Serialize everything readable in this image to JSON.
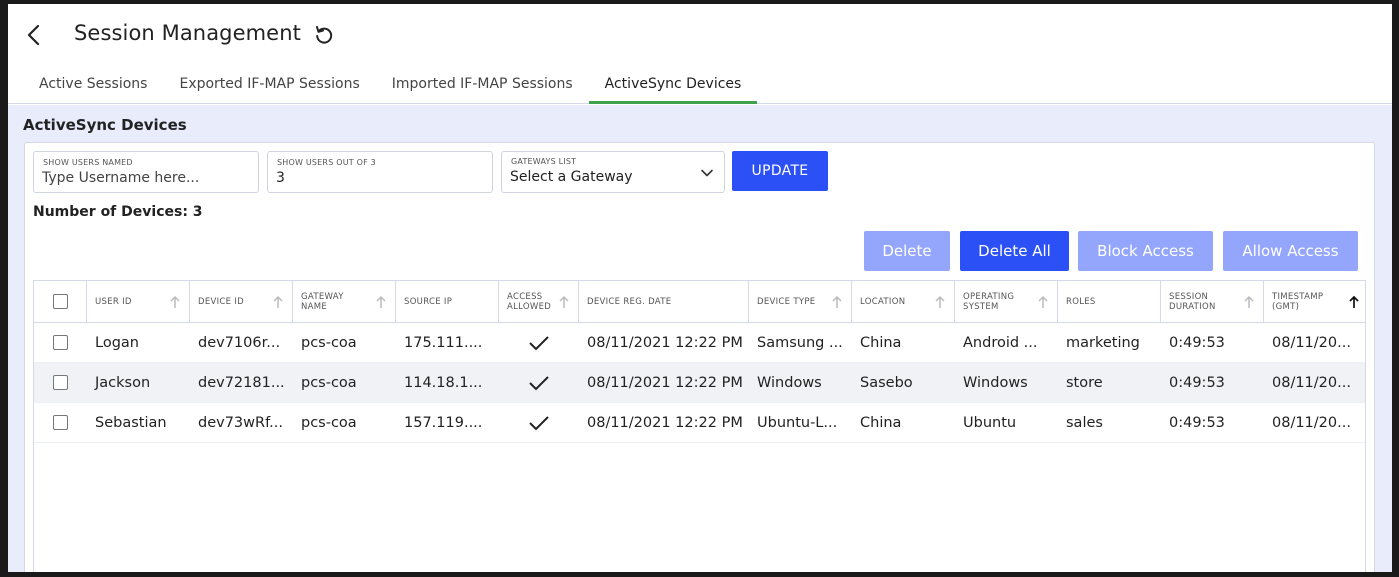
{
  "header": {
    "title": "Session Management",
    "back_icon": "chevron-left-icon",
    "refresh_icon": "refresh-icon"
  },
  "tabs": [
    {
      "label": "Active Sessions",
      "active": false
    },
    {
      "label": "Exported IF-MAP Sessions",
      "active": false
    },
    {
      "label": "Imported IF-MAP Sessions",
      "active": false
    },
    {
      "label": "ActiveSync Devices",
      "active": true
    }
  ],
  "colors": {
    "accent": "#2b50f5",
    "accent_disabled": "#94a6fb",
    "tab_underline": "#3fa34d",
    "content_bg": "#e8ecfb"
  },
  "section": {
    "title": "ActiveSync Devices"
  },
  "filters": {
    "username": {
      "label": "SHOW USERS NAMED",
      "placeholder": "Type Username here...",
      "value": ""
    },
    "limit": {
      "label": "SHOW USERS OUT OF 3",
      "value": "3"
    },
    "gateway": {
      "label": "GATEWAYS LIST",
      "value": "Select a Gateway"
    },
    "update_label": "UPDATE"
  },
  "count_text": "Number of Devices: 3",
  "actions": {
    "delete": "Delete",
    "delete_all": "Delete All",
    "block": "Block Access",
    "allow": "Allow Access"
  },
  "table": {
    "columns": [
      "USER ID",
      "DEVICE ID",
      "GATEWAY NAME",
      "SOURCE IP",
      "ACCESS ALLOWED",
      "DEVICE REG. DATE",
      "DEVICE TYPE",
      "LOCATION",
      "OPERATING SYSTEM",
      "ROLES",
      "SESSION DURATION",
      "TIMESTAMP (GMT)"
    ],
    "rows": [
      {
        "user": "Logan",
        "device": "dev7106r...",
        "gateway": "pcs-coa",
        "ip": "175.111....",
        "allowed": "✓",
        "reg": "08/11/2021 12:22 PM",
        "type": "Samsung ...",
        "location": "China",
        "os": "Android ...",
        "roles": "marketing",
        "duration": "0:49:53",
        "ts": "08/11/20..."
      },
      {
        "user": "Jackson",
        "device": "dev72181...",
        "gateway": "pcs-coa",
        "ip": "114.18.1...",
        "allowed": "✓",
        "reg": "08/11/2021 12:22 PM",
        "type": "Windows",
        "location": "Sasebo",
        "os": "Windows",
        "roles": "store",
        "duration": "0:49:53",
        "ts": "08/11/20..."
      },
      {
        "user": "Sebastian",
        "device": "dev73wRf...",
        "gateway": "pcs-coa",
        "ip": "157.119....",
        "allowed": "✓",
        "reg": "08/11/2021 12:22 PM",
        "type": "Ubuntu-L...",
        "location": "China",
        "os": "Ubuntu",
        "roles": "sales",
        "duration": "0:49:53",
        "ts": "08/11/20..."
      }
    ]
  }
}
